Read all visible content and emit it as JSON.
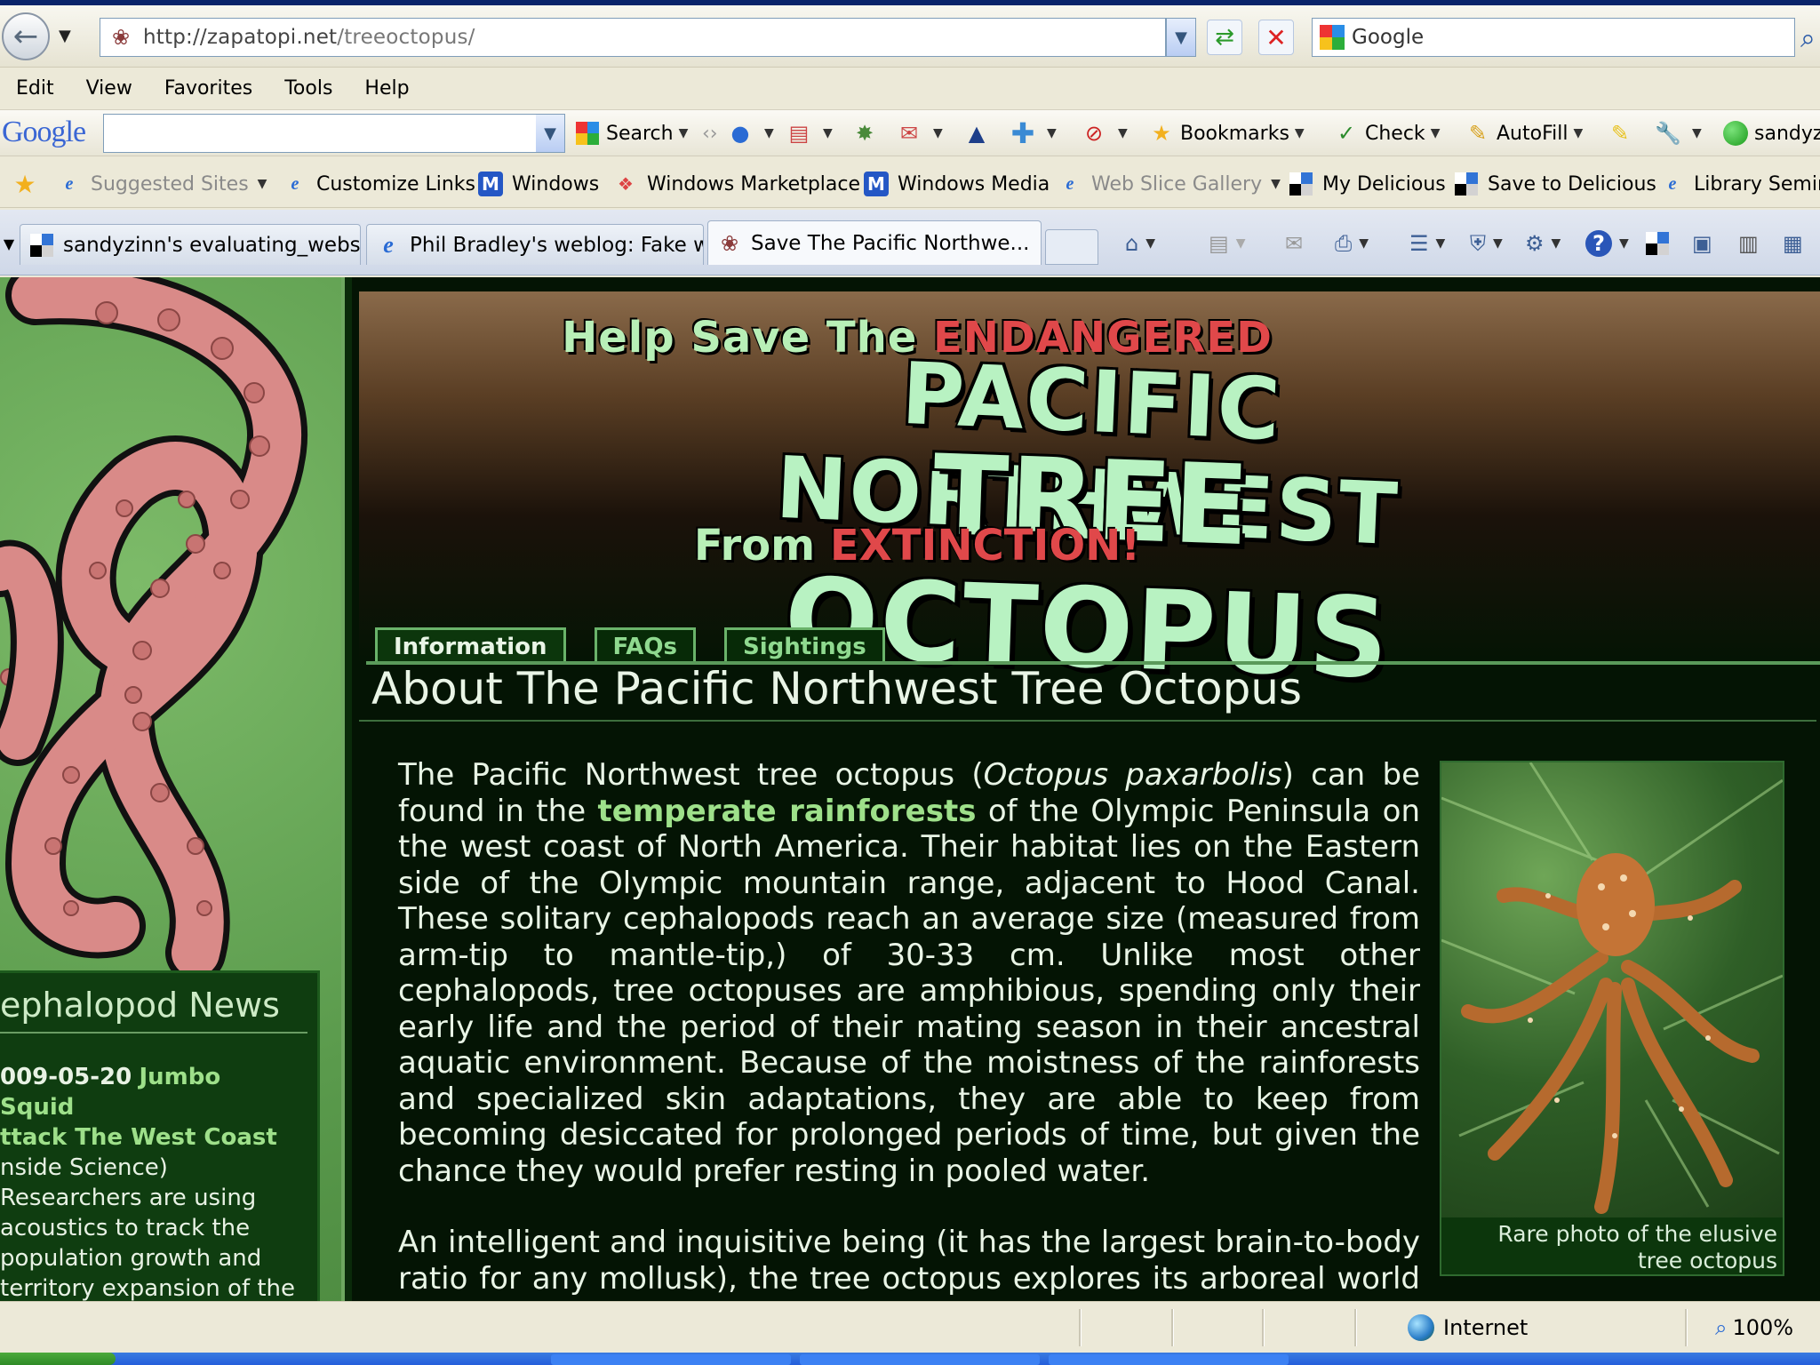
{
  "browser": {
    "address": {
      "host": "http://zapatopi.net",
      "path": "/treeoctopus/"
    },
    "search_provider": "Google",
    "menu": [
      "Edit",
      "View",
      "Favorites",
      "Tools",
      "Help"
    ],
    "google_toolbar": {
      "logo": "Google",
      "search_value": "",
      "search_label": "Search",
      "bookmarks_label": "Bookmarks",
      "check_label": "Check",
      "autofill_label": "AutoFill",
      "user_label": "sandyz"
    },
    "links": [
      {
        "label": "Suggested Sites",
        "dim": true
      },
      {
        "label": "Customize Links"
      },
      {
        "label": "Windows"
      },
      {
        "label": "Windows Marketplace"
      },
      {
        "label": "Windows Media"
      },
      {
        "label": "Web Slice Gallery",
        "dim": true
      },
      {
        "label": "My Delicious"
      },
      {
        "label": "Save to Delicious"
      },
      {
        "label": "Library Semin"
      }
    ],
    "tabs": [
      {
        "label": "sandyzinn's evaluating_webs..."
      },
      {
        "label": "Phil Bradley's weblog: Fake w..."
      },
      {
        "label": "Save The Pacific Northwe...",
        "active": true
      }
    ],
    "status": {
      "zone": "Internet",
      "zoom": "100%"
    }
  },
  "page": {
    "banner": {
      "line1_a": "Help Save The",
      "line1_b": "ENDANGERED",
      "line2": "PACIFIC NORTHWEST",
      "line3": "TREE OCTOPUS",
      "line4_a": "From",
      "line4_b": "EXTINCTION!"
    },
    "tabs": [
      "Information",
      "FAQs",
      "Sightings"
    ],
    "title": "About The Pacific Northwest Tree Octopus",
    "para1": {
      "t1": "The Pacific Northwest tree octopus (",
      "species": "Octopus paxarbolis",
      "t2": ") can be found in the ",
      "link": "temperate rainforests",
      "t3": " of the Olympic Peninsula on the west coast of North America. Their habitat lies on the Eastern side of the Olympic mountain range, adjacent to Hood Canal. These solitary cephalopods reach an average size (measured from arm-tip to mantle-tip,) of 30-33 cm. Unlike most other cephalopods, tree octopuses are amphibious, spending only their early life and the period of their mating season in their ancestral aquatic environment. Because of the moistness of the rainforests and specialized skin adaptations, they are able to keep from becoming desiccated for prolonged periods of time, but given the chance they would prefer resting in pooled water."
    },
    "para2": "An intelligent and inquisitive being (it has the largest brain-to-body ratio for any mollusk), the tree octopus explores its arboreal world by both touch and sight. Adaptations its ancestors originally evolved in the three",
    "photo_caption": "Rare photo of the elusive tree octopus",
    "news": {
      "title": "ephalopod News",
      "date": "009-05-20",
      "link_line1": "Jumbo Squid",
      "link_line2": "ttack The West Coast",
      "source": "nside Science)",
      "body": "Researchers are using acoustics to track the population growth and territory expansion of the Humboldt squid."
    }
  },
  "colors": {
    "page_bg": "#041404",
    "text": "#e9f5e6",
    "link": "#9ee08a",
    "accent_red": "#e0484a",
    "banner_green": "#b8f2c2",
    "octopus_pink": "#d98a88"
  }
}
